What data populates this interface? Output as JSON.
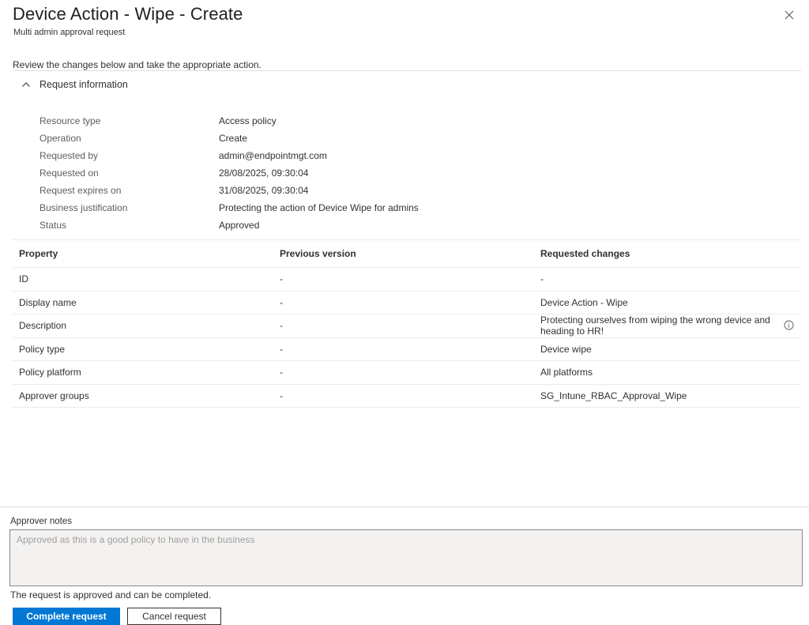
{
  "header": {
    "title": "Device Action - Wipe - Create",
    "subtitle": "Multi admin approval request"
  },
  "review_text": "Review the changes below and take the appropriate action.",
  "request_info": {
    "section_label": "Request information",
    "rows": [
      {
        "key": "Resource type",
        "value": "Access policy"
      },
      {
        "key": "Operation",
        "value": "Create"
      },
      {
        "key": "Requested by",
        "value": "admin@endpointmgt.com"
      },
      {
        "key": "Requested on",
        "value": "28/08/2025, 09:30:04"
      },
      {
        "key": "Request expires on",
        "value": "31/08/2025, 09:30:04"
      },
      {
        "key": "Business justification",
        "value": "Protecting the action of Device Wipe for admins"
      },
      {
        "key": "Status",
        "value": "Approved"
      }
    ]
  },
  "changes_table": {
    "headers": [
      "Property",
      "Previous version",
      "Requested changes"
    ],
    "rows": [
      {
        "property": "ID",
        "previous": "-",
        "requested": "-"
      },
      {
        "property": "Display name",
        "previous": "-",
        "requested": "Device Action - Wipe"
      },
      {
        "property": "Description",
        "previous": "-",
        "requested": "Protecting ourselves from wiping the wrong device and heading to HR!"
      },
      {
        "property": "Policy type",
        "previous": "-",
        "requested": "Device wipe"
      },
      {
        "property": "Policy platform",
        "previous": "-",
        "requested": "All platforms"
      },
      {
        "property": "Approver groups",
        "previous": "-",
        "requested": "SG_Intune_RBAC_Approval_Wipe"
      }
    ]
  },
  "approver_notes": {
    "label": "Approver notes",
    "value": "Approved as this is a good policy to have in the business"
  },
  "status_message": "The request is approved and can be completed.",
  "buttons": {
    "complete": "Complete request",
    "cancel": "Cancel request"
  },
  "icons": {
    "close": "close-icon",
    "collapse": "chevron-up-icon",
    "info": "info-icon"
  },
  "colors": {
    "primary": "#0078d4",
    "border": "#edebe9",
    "notes_bg": "#f3f2f1"
  }
}
